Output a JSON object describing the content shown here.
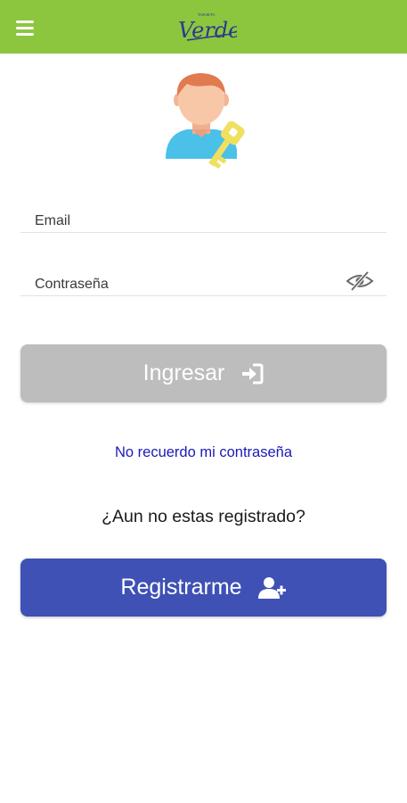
{
  "header": {
    "brand": "Verde",
    "brand_small": "TARJETA",
    "menu_icon": "hamburger-menu-icon",
    "background_color": "#8cc63f"
  },
  "login_form": {
    "email_placeholder": "Email",
    "password_placeholder": "Contraseña",
    "password_toggle_icon": "eye-slash-icon",
    "login_label": "Ingresar",
    "login_icon": "sign-in-icon",
    "forgot_password": "No recuerdo mi contraseña"
  },
  "register": {
    "question": "¿Aun no estas registrado?",
    "button_label": "Registrarme",
    "button_icon": "user-plus-icon"
  },
  "colors": {
    "accent_green": "#8cc63f",
    "primary_blue": "#3f51b5",
    "disabled_gray": "#bdbdbd",
    "link_blue": "#1b19b8"
  }
}
